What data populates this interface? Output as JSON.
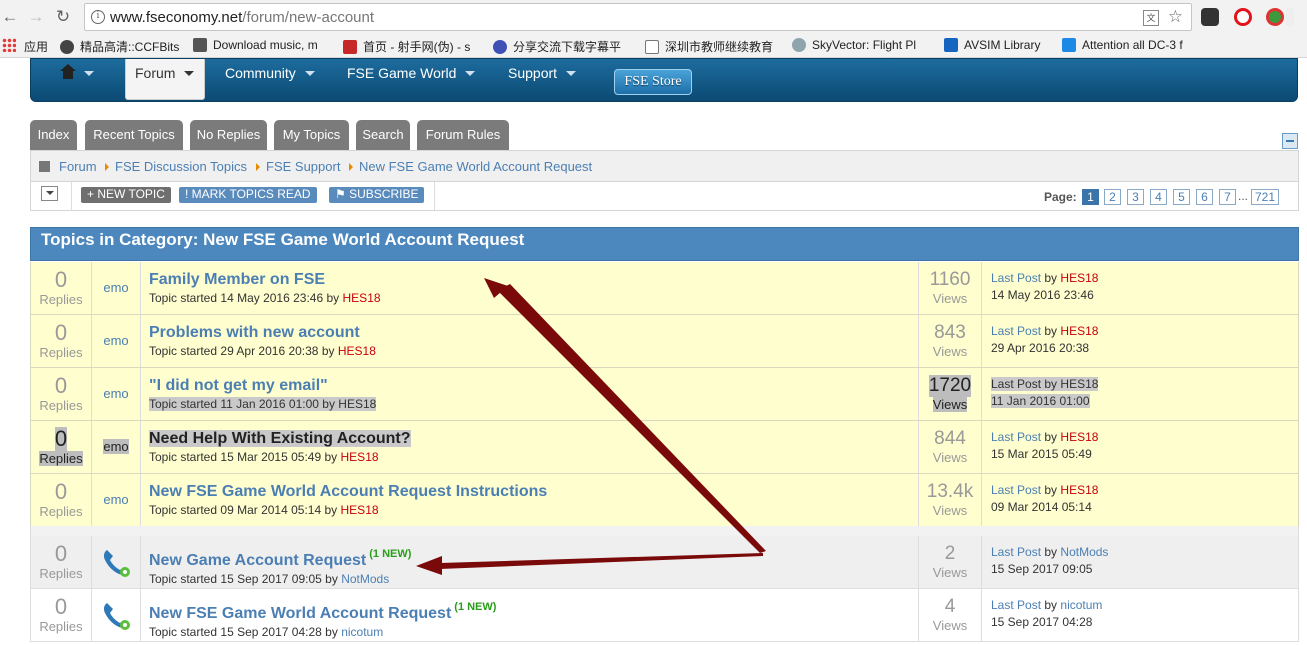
{
  "browser": {
    "url_host": "www.fseconomy.net",
    "url_path": "/forum/new-account",
    "bookmarks": [
      "应用",
      "精品高清::CCFBits",
      "Download music, m",
      "首页 - 射手网(伪) - s",
      "分享交流下载字幕平",
      "深圳市教师继续教育",
      "SkyVector: Flight Pl",
      "AVSIM Library",
      "Attention all DC-3 f"
    ]
  },
  "sitenav": {
    "items": [
      "Forum",
      "Community",
      "FSE Game World",
      "Support"
    ],
    "store": "FSE Store"
  },
  "tabs": [
    "Index",
    "Recent Topics",
    "No Replies",
    "My Topics",
    "Search",
    "Forum Rules"
  ],
  "breadcrumb": [
    "Forum",
    "FSE Discussion Topics",
    "FSE Support",
    "New FSE Game World Account Request"
  ],
  "actions": {
    "new_topic": "NEW TOPIC",
    "mark_read": "MARK TOPICS READ",
    "subscribe": "SUBSCRIBE",
    "page_label": "Page:",
    "pages": [
      "1",
      "2",
      "3",
      "4",
      "5",
      "6",
      "7",
      "...",
      "721"
    ]
  },
  "category_title": "Topics in Category: New FSE Game World Account Request",
  "labels": {
    "replies": "Replies",
    "views": "Views",
    "last_post": "Last Post",
    "by": "by",
    "topic_started": "Topic started",
    "new": "(1 NEW)"
  },
  "topics": [
    {
      "replies": "0",
      "icon": "emo",
      "title": "Family Member on FSE",
      "started": "14 May 2016 23:46",
      "author": "HES18",
      "views": "1160",
      "last_by": "HES18",
      "last_date": "14 May 2016 23:46"
    },
    {
      "replies": "0",
      "icon": "emo",
      "title": "Problems with new account",
      "started": "29 Apr 2016 20:38",
      "author": "HES18",
      "views": "843",
      "last_by": "HES18",
      "last_date": "29 Apr 2016 20:38"
    },
    {
      "replies": "0",
      "icon": "emo",
      "title": "\"I did not get my email\"",
      "started": "11 Jan 2016 01:00",
      "author": "HES18",
      "views": "1720",
      "last_by": "HES18",
      "last_date": "11 Jan 2016 01:00"
    },
    {
      "replies": "0",
      "icon": "emo",
      "title": "Need Help With Existing Account?",
      "started": "15 Mar 2015 05:49",
      "author": "HES18",
      "views": "844",
      "last_by": "HES18",
      "last_date": "15 Mar 2015 05:49"
    },
    {
      "replies": "0",
      "icon": "emo",
      "title": "New FSE Game World Account Request Instructions",
      "started": "09 Mar 2014 05:14",
      "author": "HES18",
      "views": "13.4k",
      "last_by": "HES18",
      "last_date": "09 Mar 2014 05:14"
    },
    {
      "replies": "0",
      "icon": "phone",
      "title": "New Game Account Request",
      "started": "15 Sep 2017 09:05",
      "author": "NotMods",
      "views": "2",
      "last_by": "NotMods",
      "last_date": "15 Sep 2017 09:05"
    },
    {
      "replies": "0",
      "icon": "phone",
      "title": "New FSE Game World Account Request",
      "started": "15 Sep 2017 04:28",
      "author": "nicotum",
      "views": "4",
      "last_by": "nicotum",
      "last_date": "15 Sep 2017 04:28"
    }
  ],
  "colors": {
    "nav": "#0b4a74",
    "accent": "#4c87bd",
    "sticky": "#fefecf",
    "arrow": "#7a0a0a"
  }
}
